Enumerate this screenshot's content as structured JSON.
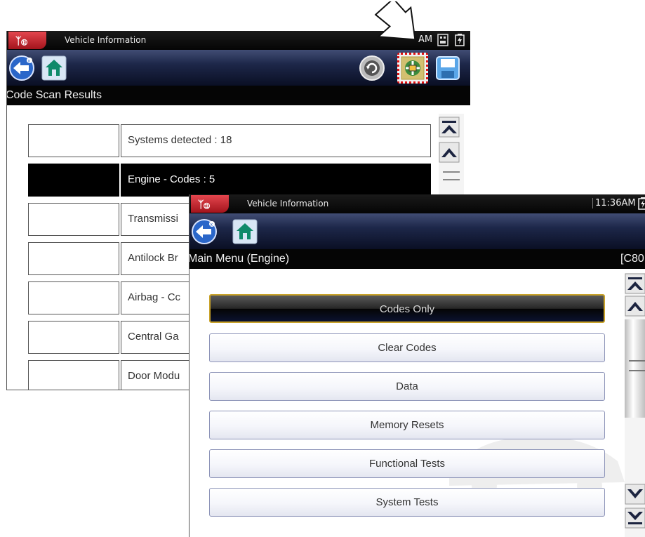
{
  "back_screen": {
    "titlebar": {
      "title": "Vehicle Information",
      "clock": "AM"
    },
    "subheader": "Code Scan Results",
    "results": [
      {
        "label": "Systems detected : 18",
        "selected": false
      },
      {
        "label": "Engine - Codes : 5",
        "selected": true
      },
      {
        "label": "Transmissi",
        "selected": false
      },
      {
        "label": "Antilock Br",
        "selected": false
      },
      {
        "label": "Airbag - Cc",
        "selected": false
      },
      {
        "label": "Central Ga",
        "selected": false
      },
      {
        "label": "Door Modu",
        "selected": false
      }
    ]
  },
  "front_screen": {
    "titlebar": {
      "title": "Vehicle Information",
      "clock": "11:36AM"
    },
    "subheader": {
      "left": "Main Menu (Engine)",
      "right": "[C80"
    },
    "menu": [
      {
        "label": "Codes Only",
        "active": true
      },
      {
        "label": "Clear Codes",
        "active": false
      },
      {
        "label": "Data",
        "active": false
      },
      {
        "label": "Memory Resets",
        "active": false
      },
      {
        "label": "Functional Tests",
        "active": false
      },
      {
        "label": "System Tests",
        "active": false
      }
    ]
  },
  "icons": {
    "back": "back-arrow-icon",
    "home": "home-icon",
    "reset": "reset-icon",
    "vehicle_system": "vehicle-system-icon",
    "save": "save-icon",
    "scroll_top": "scroll-top-icon",
    "scroll_up": "scroll-up-icon",
    "scroll_down": "scroll-down-icon",
    "scroll_bottom": "scroll-bottom-icon",
    "pointer": "pointer-arrow-icon"
  },
  "colors": {
    "toolbar_top": "#414d74",
    "toolbar_bottom": "#0a0f24",
    "logo_red": "#d43038",
    "highlight_gold": "#c9a32a",
    "callout_red": "#e01010"
  }
}
